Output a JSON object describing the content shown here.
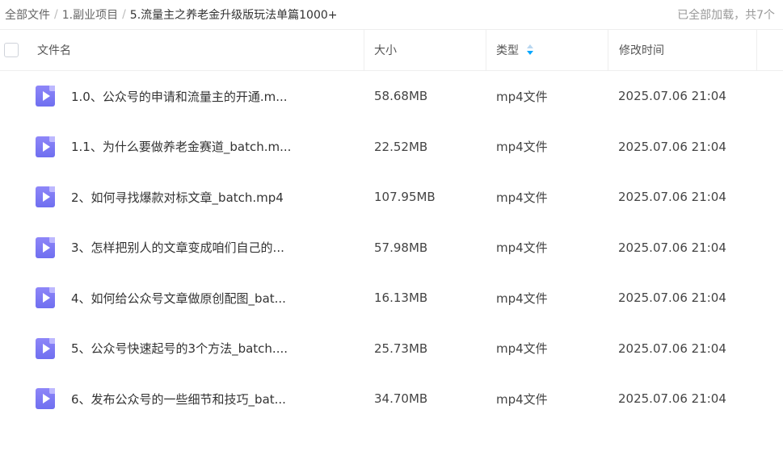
{
  "breadcrumb": {
    "items": [
      "全部文件",
      "1.副业项目",
      "5.流量主之养老金升级版玩法单篇1000+"
    ],
    "separator": "/"
  },
  "status_text": "已全部加载，共7个",
  "table": {
    "columns": {
      "name": "文件名",
      "size": "大小",
      "type": "类型",
      "modified": "修改时间"
    },
    "sort": {
      "column": "type",
      "direction": "descending"
    },
    "rows": [
      {
        "name": "1.0、公众号的申请和流量主的开通.m...",
        "size": "58.68MB",
        "type": "mp4文件",
        "modified": "2025.07.06 21:04"
      },
      {
        "name": "1.1、为什么要做养老金赛道_batch.m...",
        "size": "22.52MB",
        "type": "mp4文件",
        "modified": "2025.07.06 21:04"
      },
      {
        "name": "2、如何寻找爆款对标文章_batch.mp4",
        "size": "107.95MB",
        "type": "mp4文件",
        "modified": "2025.07.06 21:04"
      },
      {
        "name": "3、怎样把别人的文章变成咱们自己的...",
        "size": "57.98MB",
        "type": "mp4文件",
        "modified": "2025.07.06 21:04"
      },
      {
        "name": "4、如何给公众号文章做原创配图_bat...",
        "size": "16.13MB",
        "type": "mp4文件",
        "modified": "2025.07.06 21:04"
      },
      {
        "name": "5、公众号快速起号的3个方法_batch....",
        "size": "25.73MB",
        "type": "mp4文件",
        "modified": "2025.07.06 21:04"
      },
      {
        "name": "6、发布公众号的一些细节和技巧_bat...",
        "size": "34.70MB",
        "type": "mp4文件",
        "modified": "2025.07.06 21:04"
      }
    ]
  },
  "icons": {
    "file": "video-file-icon",
    "sort": "sort-arrows-icon"
  },
  "colors": {
    "video_icon": "#7b76f5",
    "sort_active": "#06a7ff"
  }
}
